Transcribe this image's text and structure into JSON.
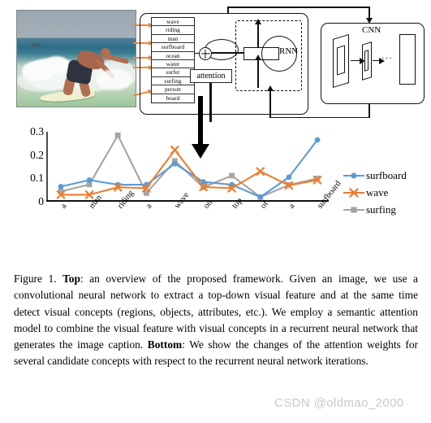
{
  "figure": {
    "caption_prefix": "Figure 1. ",
    "bold_top": "Top",
    "caption_part1": ": an overview of the proposed framework. Given an image, we use a convolutional neural network to extract a top-down visual feature and at the same time detect visual concepts (regions, objects, attributes, etc.). We employ a semantic attention model to combine the visual feature with visual concepts in a recurrent neural network that generates the image caption. ",
    "bold_bottom": "Bottom",
    "caption_part2": ": We show the changes of the attention weights for several candidate concepts with respect to the recurrent neural network iterations."
  },
  "watermark": "CSDN @oldmao_2000",
  "diagram": {
    "photo_alt": "surfer-riding-wave-photo",
    "concept_list": [
      "wave",
      "riding",
      "man",
      "surfboard",
      "ocean",
      "water",
      "surfer",
      "surfing",
      "person",
      "board"
    ],
    "attention_label": "attention",
    "rnn_label": "RNN",
    "cnn_label": "CNN",
    "cnn_dots": "···",
    "plus_symbol": "+"
  },
  "colors": {
    "surfboard": "#5b9bd5",
    "wave": "#ed7d31",
    "surfing": "#a5a5a5",
    "axis": "#111111",
    "watermark": "#c9c9c9"
  },
  "chart_data": {
    "type": "line",
    "title": "",
    "xlabel": "",
    "ylabel": "",
    "ylim": [
      0,
      0.3
    ],
    "yticks": [
      "0",
      "0.1",
      "0.2",
      "0.3"
    ],
    "ytick_values": [
      0,
      0.1,
      0.2,
      0.3
    ],
    "grid": false,
    "legend_position": "right",
    "categories": [
      "a",
      "man",
      "riding",
      "a",
      "wave",
      "on",
      "top",
      "of",
      "a",
      "surfboard"
    ],
    "series": [
      {
        "name": "surfboard",
        "color": "#5b9bd5",
        "marker": "circle",
        "values": [
          0.065,
          0.093,
          0.073,
          0.073,
          0.163,
          0.085,
          0.073,
          0.02,
          0.105,
          0.265
        ]
      },
      {
        "name": "wave",
        "color": "#ed7d31",
        "marker": "cross",
        "values": [
          0.03,
          0.03,
          0.062,
          0.058,
          0.222,
          0.063,
          0.058,
          0.13,
          0.07,
          0.093
        ]
      },
      {
        "name": "surfing",
        "color": "#a5a5a5",
        "marker": "square",
        "values": [
          0.044,
          0.074,
          0.285,
          0.037,
          0.175,
          0.062,
          0.112,
          0.02,
          0.072,
          0.1
        ]
      }
    ]
  }
}
